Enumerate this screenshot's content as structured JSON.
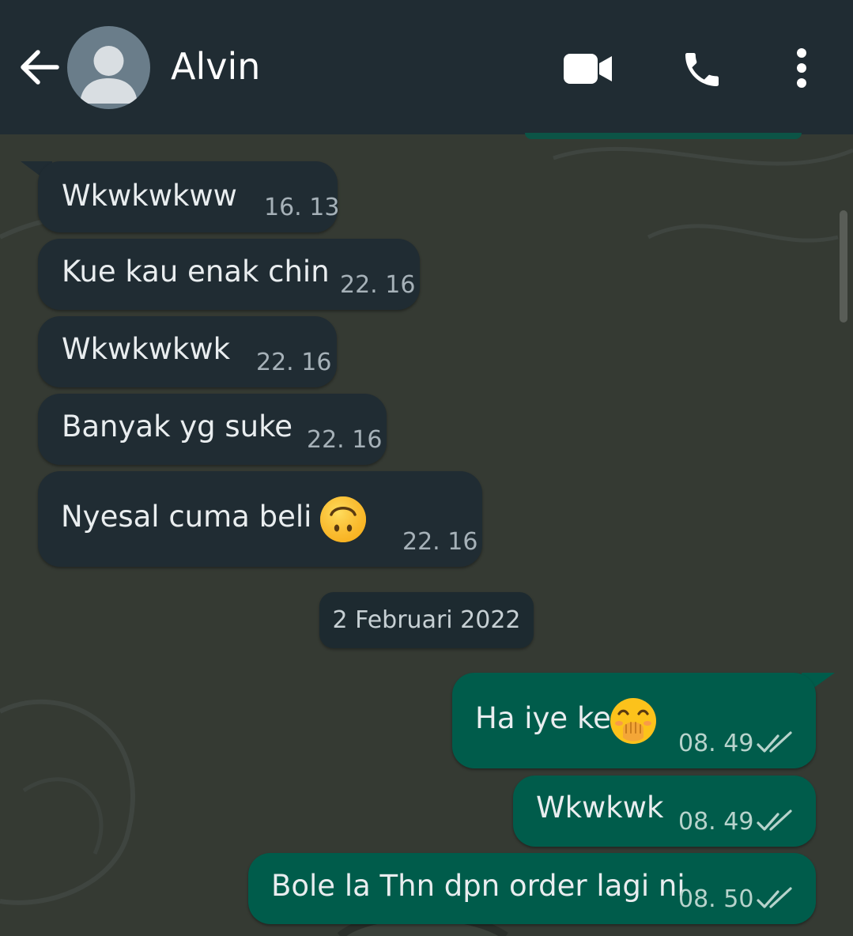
{
  "header": {
    "contact_name": "Alvin",
    "icons": [
      "back-arrow-icon",
      "avatar-placeholder-icon",
      "video-call-icon",
      "voice-call-icon",
      "more-options-icon"
    ]
  },
  "messages_before": [
    {
      "text": "Wkwkwkww",
      "time": "16. 13",
      "direction": "incoming"
    },
    {
      "text": "Kue kau enak chin",
      "time": "22. 16",
      "direction": "incoming"
    },
    {
      "text": "Wkwkwkwk",
      "time": "22. 16",
      "direction": "incoming"
    },
    {
      "text": "Banyak yg suke",
      "time": "22. 16",
      "direction": "incoming"
    },
    {
      "text": "Nyesal cuma beli 1",
      "emoji": "upside-down-face",
      "time": "22. 16",
      "direction": "incoming"
    }
  ],
  "date_separator": "2 Februari 2022",
  "messages_after": [
    {
      "text": "Ha iye ke",
      "emoji": "face-with-hand-over-mouth",
      "time": "08. 49",
      "direction": "outgoing",
      "status": "read"
    },
    {
      "text": "Wkwkwk",
      "time": "08. 49",
      "direction": "outgoing",
      "status": "read"
    },
    {
      "text": "Bole la Thn dpn order lagi ni",
      "time": "08. 50",
      "direction": "outgoing",
      "status": "read"
    }
  ],
  "colors": {
    "header": "#202c33",
    "incoming_bubble": "#202c33",
    "outgoing_bubble": "#005c4b",
    "chat_background": "#353a33",
    "read_ticks": "#b7d3cc"
  }
}
